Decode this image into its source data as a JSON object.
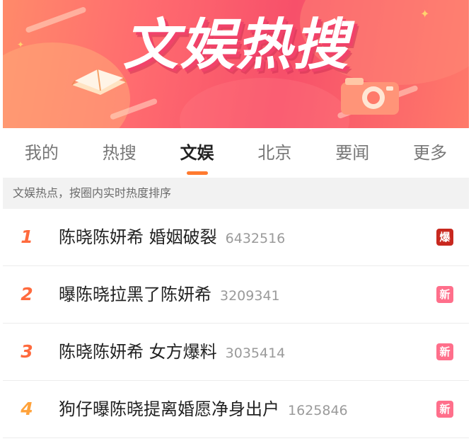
{
  "banner": {
    "title": "文娱热搜"
  },
  "tabs": [
    {
      "label": "我的",
      "active": false
    },
    {
      "label": "热搜",
      "active": false
    },
    {
      "label": "文娱",
      "active": true
    },
    {
      "label": "北京",
      "active": false
    },
    {
      "label": "要闻",
      "active": false
    },
    {
      "label": "更多",
      "active": false
    }
  ],
  "hint": "文娱热点，按圈内实时热度排序",
  "items": [
    {
      "rank": "1",
      "title": "陈晓陈妍希 婚姻破裂",
      "count": "6432516",
      "badge": "爆"
    },
    {
      "rank": "2",
      "title": "曝陈晓拉黑了陈妍希",
      "count": "3209341",
      "badge": "新"
    },
    {
      "rank": "3",
      "title": "陈晓陈妍希 女方爆料",
      "count": "3035414",
      "badge": "新"
    },
    {
      "rank": "4",
      "title": "狗仔曝陈晓提离婚愿净身出户",
      "count": "1625846",
      "badge": "新"
    }
  ],
  "colors": {
    "accent": "#ff7a2f",
    "rank_top": "#ff6a3d",
    "rank_4": "#ffa23a",
    "badge_hot": "#c8281f",
    "badge_new": "#ff6f8b"
  }
}
